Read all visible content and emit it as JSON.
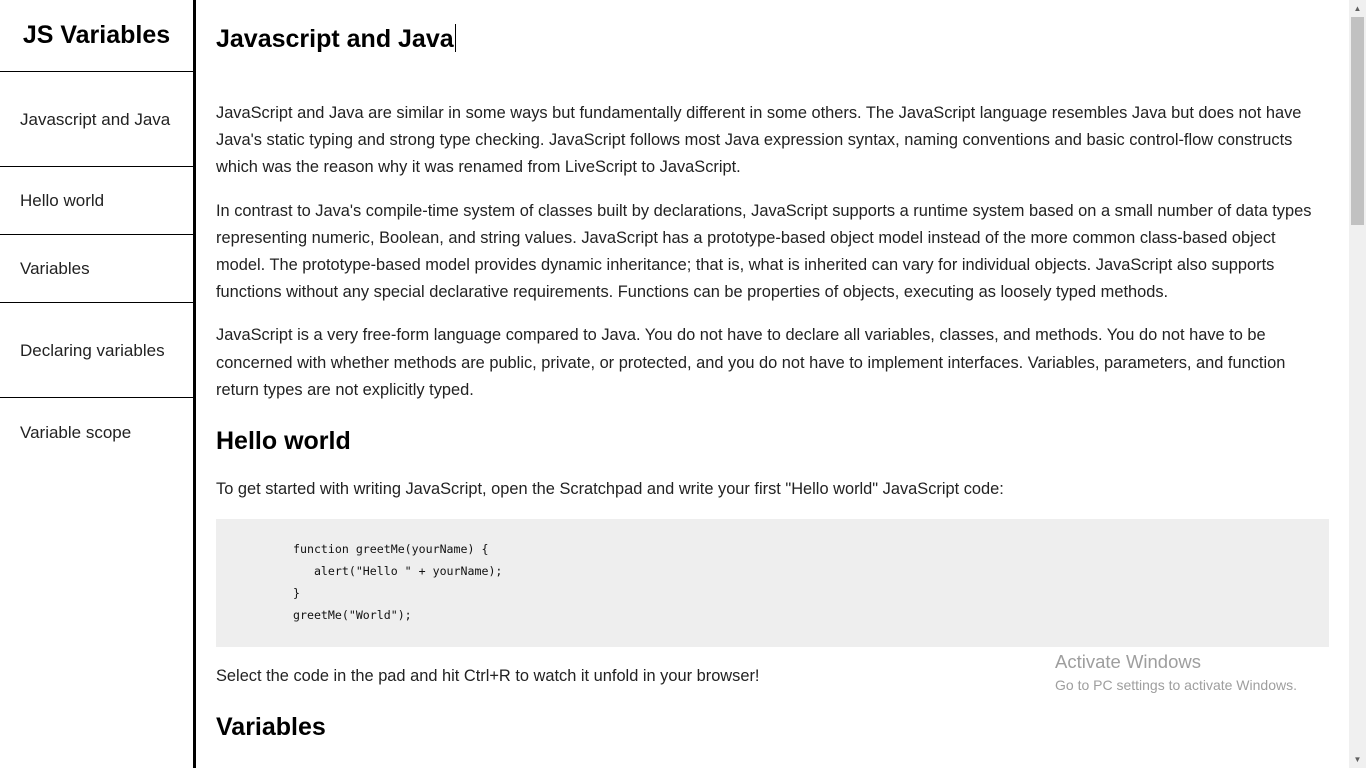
{
  "sidebar": {
    "title": "JS Variables",
    "items": [
      {
        "label": "Javascript and Java"
      },
      {
        "label": "Hello world"
      },
      {
        "label": "Variables"
      },
      {
        "label": "Declaring variables"
      },
      {
        "label": "Variable scope"
      }
    ]
  },
  "main": {
    "sections": {
      "java": {
        "title": "Javascript and Java",
        "paragraphs": [
          "JavaScript and Java are similar in some ways but fundamentally different in some others. The JavaScript language resembles Java but does not have Java's static typing and strong type checking. JavaScript follows most Java expression syntax, naming conventions and basic control-flow constructs which was the reason why it was renamed from LiveScript to JavaScript.",
          "In contrast to Java's compile-time system of classes built by declarations, JavaScript supports a runtime system based on a small number of data types representing numeric, Boolean, and string values. JavaScript has a prototype-based object model instead of the more common class-based object model. The prototype-based model provides dynamic inheritance; that is, what is inherited can vary for individual objects. JavaScript also supports functions without any special declarative requirements. Functions can be properties of objects, executing as loosely typed methods.",
          "JavaScript is a very free-form language compared to Java. You do not have to declare all variables, classes, and methods. You do not have to be concerned with whether methods are public, private, or protected, and you do not have to implement interfaces. Variables, parameters, and function return types are not explicitly typed."
        ]
      },
      "hello": {
        "title": "Hello world",
        "intro": "To get started with writing JavaScript, open the Scratchpad and write your first \"Hello world\" JavaScript code:",
        "code": "function greetMe(yourName) {\n   alert(\"Hello \" + yourName);\n}\ngreetMe(\"World\");",
        "outro": "Select the code in the pad and hit Ctrl+R to watch it unfold in your browser!"
      },
      "variables": {
        "title": "Variables"
      }
    }
  },
  "watermark": {
    "title": "Activate Windows",
    "subtitle": "Go to PC settings to activate Windows."
  },
  "scrollbar": {
    "up_icon": "arrow-up-icon",
    "down_icon": "arrow-down-icon"
  }
}
